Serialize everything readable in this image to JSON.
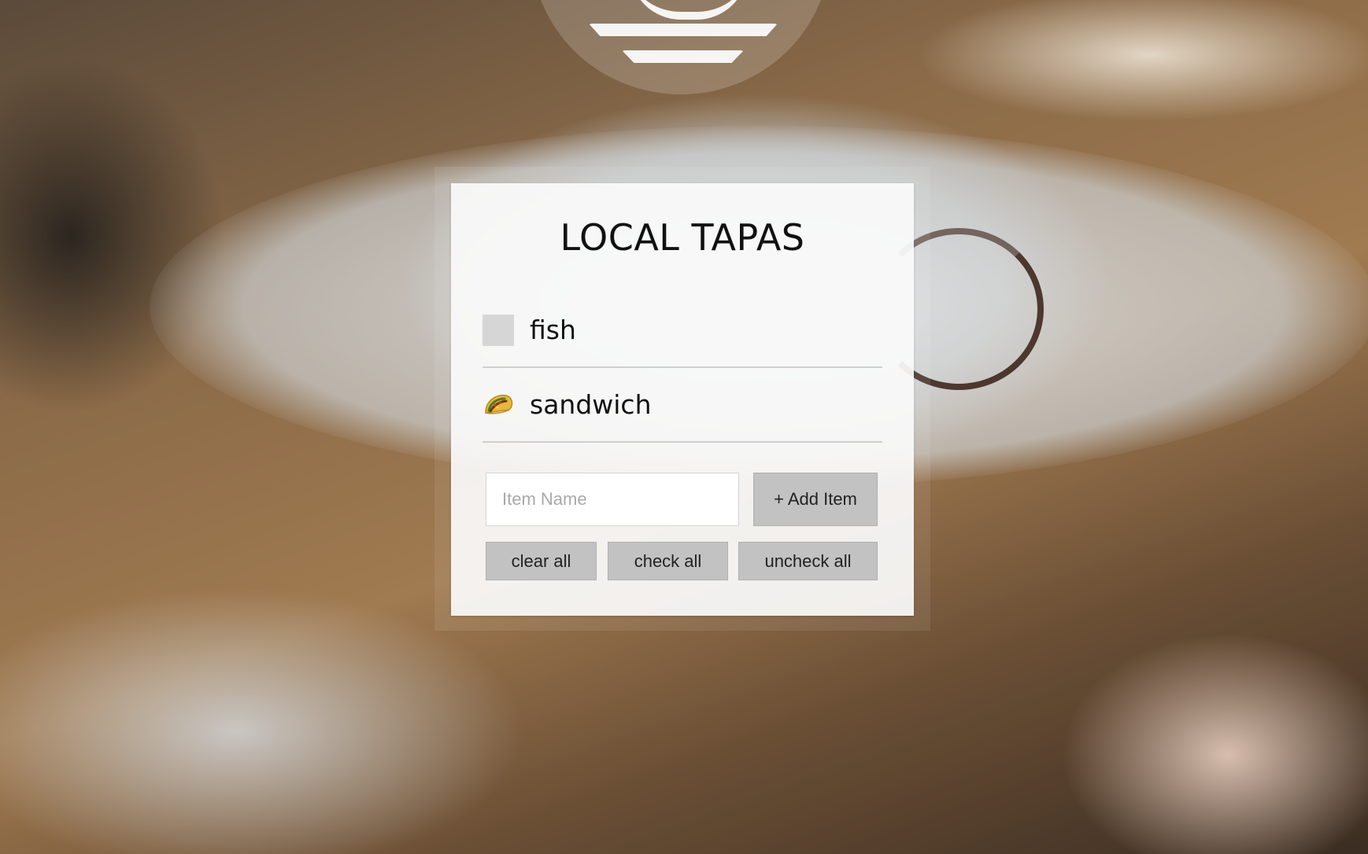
{
  "app": {
    "title": "LOCAL TAPAS"
  },
  "items": [
    {
      "label": "fish",
      "checked": false,
      "check_icon": "empty-checkbox"
    },
    {
      "label": "sandwich",
      "checked": true,
      "check_icon": "taco-icon"
    }
  ],
  "add_form": {
    "input_placeholder": "Item Name",
    "input_value": "",
    "add_button_label": "+ Add Item"
  },
  "actions": {
    "clear_all_label": "clear all",
    "check_all_label": "check all",
    "uncheck_all_label": "uncheck all"
  },
  "colors": {
    "card_background": "#fafafa",
    "button_background": "#c2c2c2",
    "unchecked_box": "#d6d6d6",
    "divider": "#cfcfcf"
  }
}
